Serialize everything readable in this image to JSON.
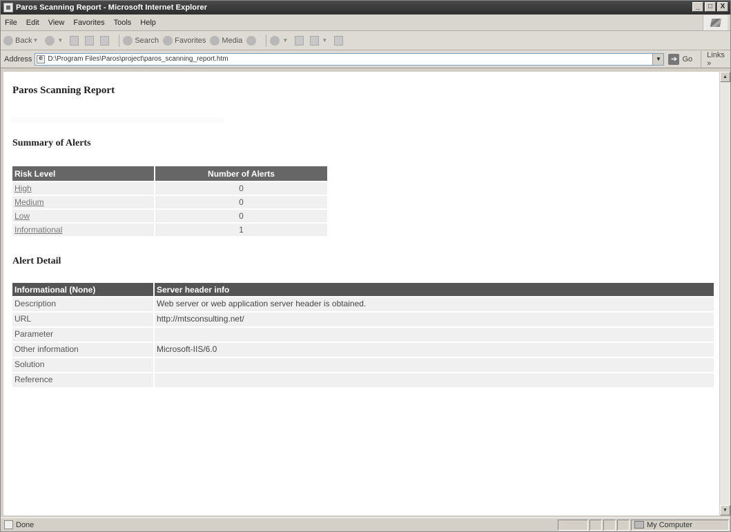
{
  "window": {
    "title": "Paros Scanning Report - Microsoft Internet Explorer",
    "controls": {
      "minimize": "_",
      "maximize": "□",
      "close": "X"
    }
  },
  "menu": [
    "File",
    "Edit",
    "View",
    "Favorites",
    "Tools",
    "Help"
  ],
  "toolbar": {
    "back": "Back",
    "search": "Search",
    "favorites": "Favorites",
    "media": "Media"
  },
  "address": {
    "label": "Address",
    "url": "D:\\Program Files\\Paros\\project\\paros_scanning_report.htm",
    "go": "Go",
    "links": "Links »"
  },
  "report": {
    "title": "Paros Scanning Report",
    "summary_heading": "Summary of Alerts",
    "summary_headers": [
      "Risk Level",
      "Number of Alerts"
    ],
    "summary_rows": [
      {
        "level": "High",
        "count": "0"
      },
      {
        "level": "Medium",
        "count": "0"
      },
      {
        "level": "Low",
        "count": "0"
      },
      {
        "level": "Informational",
        "count": "1"
      }
    ],
    "detail_heading": "Alert Detail",
    "detail_headers": [
      "Informational (None)",
      "Server header info"
    ],
    "detail_rows": [
      {
        "label": "Description",
        "value": "Web server or web application server header is obtained."
      },
      {
        "label": "URL",
        "value": "http://mtsconsulting.net/"
      },
      {
        "label": "Parameter",
        "value": ""
      },
      {
        "label": "Other information",
        "value": "Microsoft-IIS/6.0"
      },
      {
        "label": "Solution",
        "value": ""
      },
      {
        "label": "Reference",
        "value": ""
      }
    ]
  },
  "status": {
    "text": "Done",
    "zone": "My Computer"
  }
}
